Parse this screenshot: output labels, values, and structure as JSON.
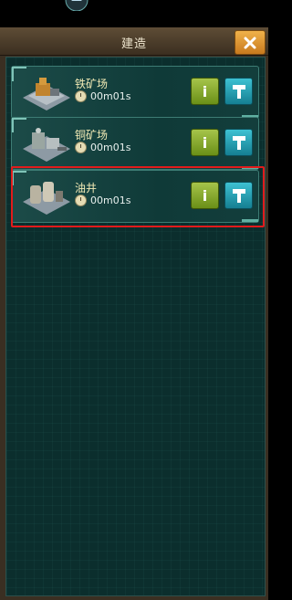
{
  "header": {
    "title": "建造",
    "close_icon": "close-icon"
  },
  "buildings": [
    {
      "name": "铁矿场",
      "time": "00m01s",
      "thumb": "iron-mine"
    },
    {
      "name": "铜矿场",
      "time": "00m01s",
      "thumb": "copper-mine"
    },
    {
      "name": "油井",
      "time": "00m01s",
      "thumb": "oil-well"
    }
  ],
  "buttons": {
    "info_label": "i"
  },
  "colors": {
    "accent": "#e21b1b",
    "panel": "#0b2e2d",
    "info": "#8aab2f",
    "build": "#2aa3b5"
  }
}
